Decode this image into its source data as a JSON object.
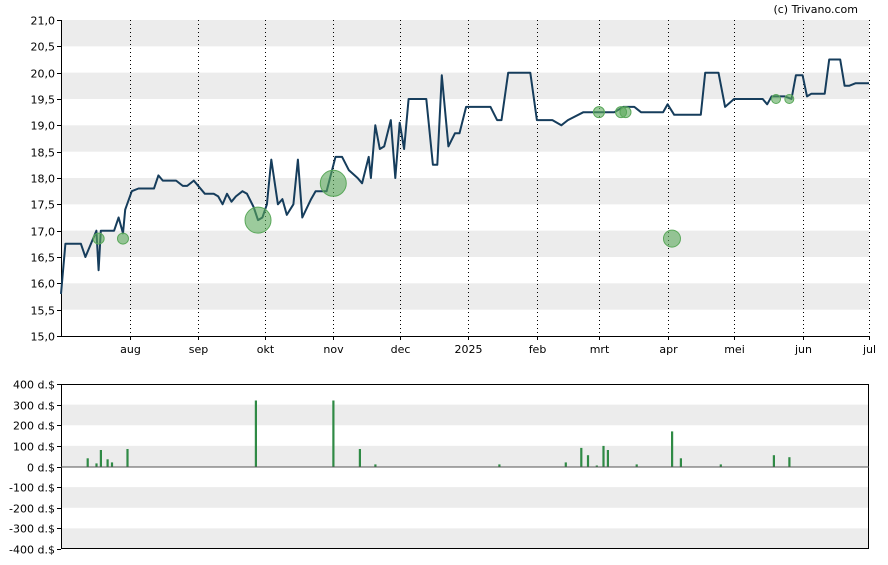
{
  "credit": "(c) Trivano.com",
  "colors": {
    "line": "#163d5c",
    "bubble": "#5aa85a",
    "bar": "#2f8a45",
    "band": "#ececec",
    "axis": "#000000"
  },
  "chart_data": [
    {
      "type": "line",
      "subtype": "price-with-bubbles",
      "title": "",
      "xlabel": "",
      "ylabel": "",
      "ylim": [
        15.0,
        21.0
      ],
      "y_ticks": [
        "15,0",
        "15,5",
        "16,0",
        "16,5",
        "17,0",
        "17,5",
        "18,0",
        "18,5",
        "19,0",
        "19,5",
        "20,0",
        "20,5",
        "21,0"
      ],
      "y_tick_values": [
        15.0,
        15.5,
        16.0,
        16.5,
        17.0,
        17.5,
        18.0,
        18.5,
        19.0,
        19.5,
        20.0,
        20.5,
        21.0
      ],
      "x_range": [
        "2024-07-01",
        "2025-07-01"
      ],
      "x_ticks": [
        {
          "label": "aug",
          "date": "2024-08-01"
        },
        {
          "label": "sep",
          "date": "2024-09-01"
        },
        {
          "label": "okt",
          "date": "2024-10-01"
        },
        {
          "label": "nov",
          "date": "2024-11-01"
        },
        {
          "label": "dec",
          "date": "2024-12-01"
        },
        {
          "label": "2025",
          "date": "2025-01-01"
        },
        {
          "label": "feb",
          "date": "2025-02-01"
        },
        {
          "label": "mrt",
          "date": "2025-03-01"
        },
        {
          "label": "apr",
          "date": "2025-04-01"
        },
        {
          "label": "mei",
          "date": "2025-05-01"
        },
        {
          "label": "jun",
          "date": "2025-06-01"
        },
        {
          "label": "jul",
          "date": "2025-07-01"
        }
      ],
      "grid": true,
      "series": [
        {
          "points": [
            [
              "2024-07-01",
              15.8
            ],
            [
              "2024-07-03",
              16.75
            ],
            [
              "2024-07-10",
              16.75
            ],
            [
              "2024-07-12",
              16.5
            ],
            [
              "2024-07-15",
              16.8
            ],
            [
              "2024-07-17",
              17.0
            ],
            [
              "2024-07-18",
              16.25
            ],
            [
              "2024-07-19",
              17.0
            ],
            [
              "2024-07-25",
              17.0
            ],
            [
              "2024-07-27",
              17.25
            ],
            [
              "2024-07-29",
              16.95
            ],
            [
              "2024-07-30",
              17.4
            ],
            [
              "2024-08-02",
              17.75
            ],
            [
              "2024-08-05",
              17.8
            ],
            [
              "2024-08-12",
              17.8
            ],
            [
              "2024-08-14",
              18.05
            ],
            [
              "2024-08-16",
              17.95
            ],
            [
              "2024-08-22",
              17.95
            ],
            [
              "2024-08-25",
              17.85
            ],
            [
              "2024-08-27",
              17.85
            ],
            [
              "2024-08-30",
              17.95
            ],
            [
              "2024-09-04",
              17.7
            ],
            [
              "2024-09-08",
              17.7
            ],
            [
              "2024-09-10",
              17.65
            ],
            [
              "2024-09-12",
              17.5
            ],
            [
              "2024-09-14",
              17.7
            ],
            [
              "2024-09-16",
              17.55
            ],
            [
              "2024-09-18",
              17.65
            ],
            [
              "2024-09-21",
              17.75
            ],
            [
              "2024-09-23",
              17.7
            ],
            [
              "2024-09-26",
              17.45
            ],
            [
              "2024-09-28",
              17.2
            ],
            [
              "2024-09-30",
              17.25
            ],
            [
              "2024-10-02",
              17.5
            ],
            [
              "2024-10-04",
              18.35
            ],
            [
              "2024-10-07",
              17.5
            ],
            [
              "2024-10-09",
              17.6
            ],
            [
              "2024-10-11",
              17.3
            ],
            [
              "2024-10-14",
              17.5
            ],
            [
              "2024-10-16",
              18.35
            ],
            [
              "2024-10-18",
              17.25
            ],
            [
              "2024-10-22",
              17.6
            ],
            [
              "2024-10-24",
              17.75
            ],
            [
              "2024-10-29",
              17.75
            ],
            [
              "2024-11-02",
              18.4
            ],
            [
              "2024-11-05",
              18.4
            ],
            [
              "2024-11-08",
              18.15
            ],
            [
              "2024-11-12",
              18.0
            ],
            [
              "2024-11-14",
              17.9
            ],
            [
              "2024-11-17",
              18.4
            ],
            [
              "2024-11-18",
              18.0
            ],
            [
              "2024-11-20",
              19.0
            ],
            [
              "2024-11-22",
              18.55
            ],
            [
              "2024-11-24",
              18.6
            ],
            [
              "2024-11-27",
              19.1
            ],
            [
              "2024-11-29",
              18.0
            ],
            [
              "2024-12-01",
              19.05
            ],
            [
              "2024-12-03",
              18.55
            ],
            [
              "2024-12-05",
              19.5
            ],
            [
              "2024-12-13",
              19.5
            ],
            [
              "2024-12-16",
              18.25
            ],
            [
              "2024-12-18",
              18.25
            ],
            [
              "2024-12-20",
              19.95
            ],
            [
              "2024-12-23",
              18.6
            ],
            [
              "2024-12-26",
              18.85
            ],
            [
              "2024-12-28",
              18.85
            ],
            [
              "2024-12-31",
              19.35
            ],
            [
              "2025-01-11",
              19.35
            ],
            [
              "2025-01-14",
              19.1
            ],
            [
              "2025-01-16",
              19.1
            ],
            [
              "2025-01-19",
              20.0
            ],
            [
              "2025-01-29",
              20.0
            ],
            [
              "2025-02-01",
              19.1
            ],
            [
              "2025-02-08",
              19.1
            ],
            [
              "2025-02-12",
              19.0
            ],
            [
              "2025-02-15",
              19.1
            ],
            [
              "2025-02-22",
              19.25
            ],
            [
              "2025-02-28",
              19.25
            ],
            [
              "2025-03-04",
              19.25
            ],
            [
              "2025-03-08",
              19.25
            ],
            [
              "2025-03-12",
              19.35
            ],
            [
              "2025-03-17",
              19.35
            ],
            [
              "2025-03-20",
              19.25
            ],
            [
              "2025-03-25",
              19.25
            ],
            [
              "2025-03-30",
              19.25
            ],
            [
              "2025-04-01",
              19.4
            ],
            [
              "2025-04-04",
              19.2
            ],
            [
              "2025-04-11",
              19.2
            ],
            [
              "2025-04-16",
              19.2
            ],
            [
              "2025-04-18",
              20.0
            ],
            [
              "2025-04-24",
              20.0
            ],
            [
              "2025-04-27",
              19.35
            ],
            [
              "2025-05-01",
              19.5
            ],
            [
              "2025-05-14",
              19.5
            ],
            [
              "2025-05-16",
              19.4
            ],
            [
              "2025-05-18",
              19.55
            ],
            [
              "2025-05-24",
              19.55
            ],
            [
              "2025-05-27",
              19.5
            ],
            [
              "2025-05-29",
              19.95
            ],
            [
              "2025-06-01",
              19.95
            ],
            [
              "2025-06-03",
              19.55
            ],
            [
              "2025-06-05",
              19.6
            ],
            [
              "2025-06-11",
              19.6
            ],
            [
              "2025-06-13",
              20.25
            ],
            [
              "2025-06-18",
              20.25
            ],
            [
              "2025-06-20",
              19.75
            ],
            [
              "2025-06-22",
              19.75
            ],
            [
              "2025-06-25",
              19.8
            ],
            [
              "2025-07-01",
              19.8
            ]
          ]
        }
      ],
      "bubbles": [
        {
          "date": "2024-07-18",
          "value": 16.85,
          "size": 0.25
        },
        {
          "date": "2024-07-29",
          "value": 16.85,
          "size": 0.25
        },
        {
          "date": "2024-09-28",
          "value": 17.2,
          "size": 1.0
        },
        {
          "date": "2024-11-01",
          "value": 17.9,
          "size": 1.0
        },
        {
          "date": "2025-03-01",
          "value": 19.25,
          "size": 0.25
        },
        {
          "date": "2025-03-11",
          "value": 19.25,
          "size": 0.25
        },
        {
          "date": "2025-03-13",
          "value": 19.25,
          "size": 0.25
        },
        {
          "date": "2025-04-03",
          "value": 16.85,
          "size": 0.55
        },
        {
          "date": "2025-05-20",
          "value": 19.5,
          "size": 0.15
        },
        {
          "date": "2025-05-26",
          "value": 19.5,
          "size": 0.15
        }
      ]
    },
    {
      "type": "bar",
      "title": "",
      "xlabel": "",
      "ylabel": "",
      "ylim": [
        -400,
        400
      ],
      "y_ticks": [
        "400 d.$",
        "300 d.$",
        "200 d.$",
        "100 d.$",
        "0 d.$",
        "-100 d.$",
        "-200 d.$",
        "-300 d.$",
        "-400 d.$"
      ],
      "y_tick_values": [
        400,
        300,
        200,
        100,
        0,
        -100,
        -200,
        -300,
        -400
      ],
      "x_range": [
        "2024-07-01",
        "2025-07-01"
      ],
      "grid": true,
      "bars": [
        {
          "date": "2024-07-13",
          "value": 40
        },
        {
          "date": "2024-07-17",
          "value": 15
        },
        {
          "date": "2024-07-19",
          "value": 80
        },
        {
          "date": "2024-07-22",
          "value": 35
        },
        {
          "date": "2024-07-24",
          "value": 20
        },
        {
          "date": "2024-07-31",
          "value": 85
        },
        {
          "date": "2024-09-27",
          "value": 320
        },
        {
          "date": "2024-11-01",
          "value": 320
        },
        {
          "date": "2024-11-13",
          "value": 85
        },
        {
          "date": "2024-11-20",
          "value": 10
        },
        {
          "date": "2025-01-15",
          "value": 10
        },
        {
          "date": "2025-02-14",
          "value": 20
        },
        {
          "date": "2025-02-21",
          "value": 90
        },
        {
          "date": "2025-02-24",
          "value": 55
        },
        {
          "date": "2025-02-28",
          "value": 5
        },
        {
          "date": "2025-03-03",
          "value": 100
        },
        {
          "date": "2025-03-05",
          "value": 80
        },
        {
          "date": "2025-03-18",
          "value": 10
        },
        {
          "date": "2025-04-03",
          "value": 170
        },
        {
          "date": "2025-04-07",
          "value": 40
        },
        {
          "date": "2025-04-25",
          "value": 10
        },
        {
          "date": "2025-05-19",
          "value": 55
        },
        {
          "date": "2025-05-26",
          "value": 45
        }
      ]
    }
  ]
}
